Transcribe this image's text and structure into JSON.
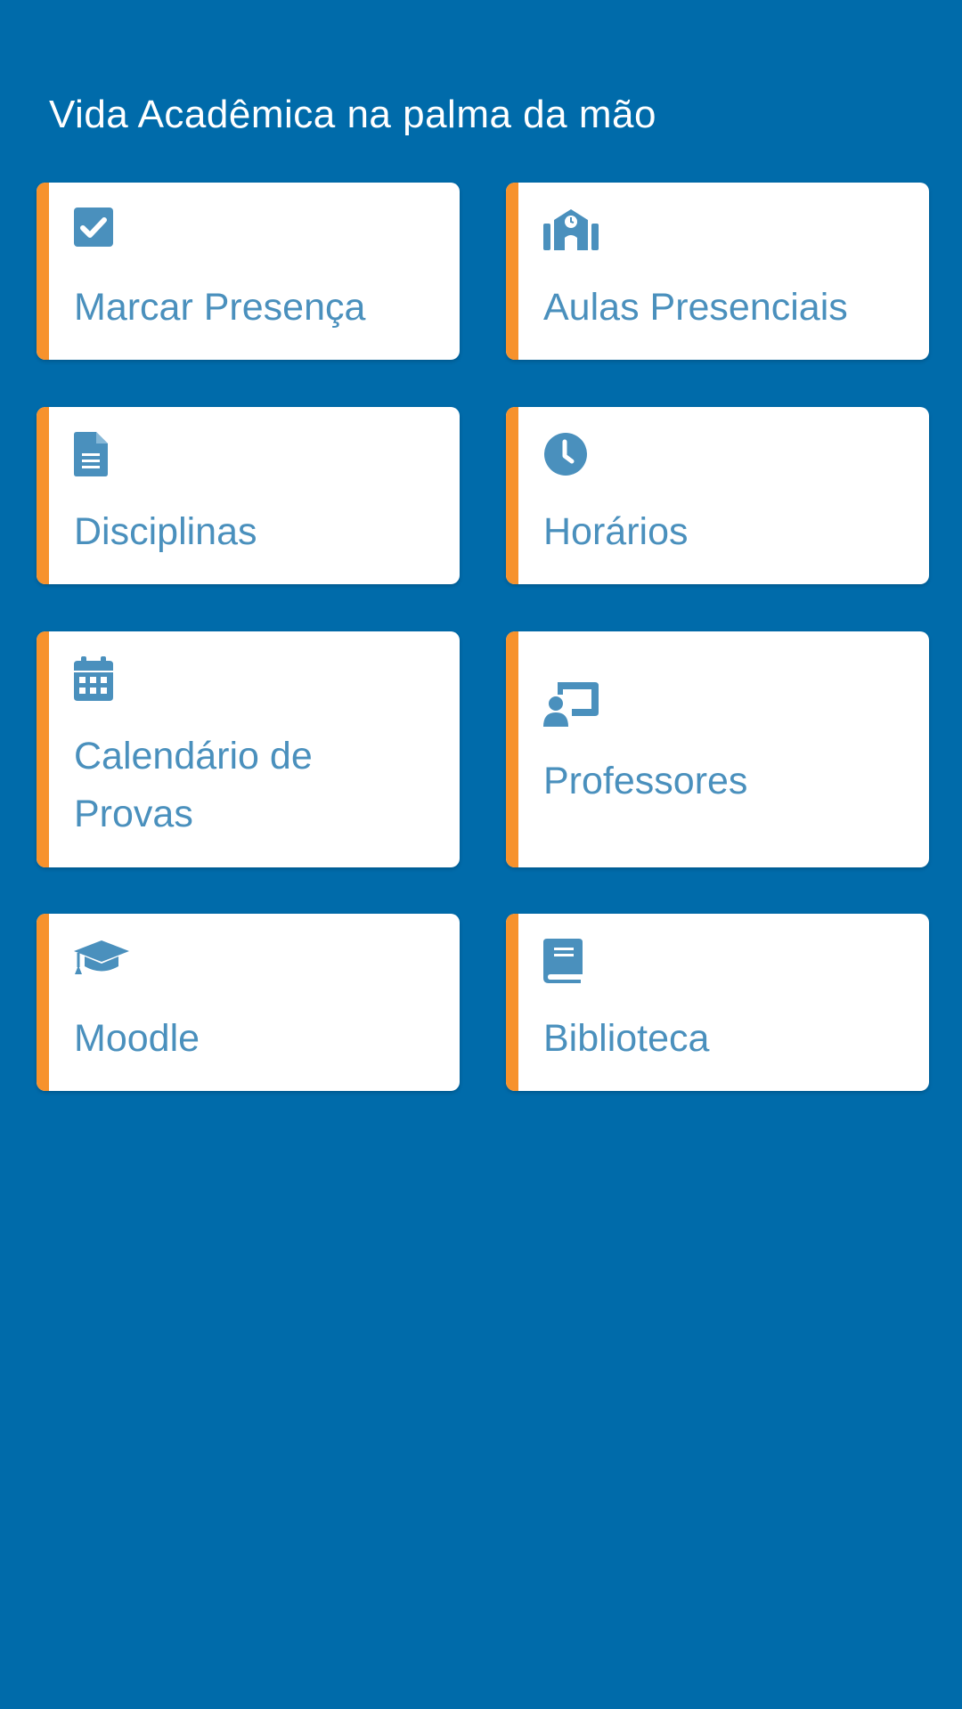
{
  "header": {
    "title": "Vida Acadêmica na palma da mão"
  },
  "theme": {
    "background": "#006BAA",
    "card_background": "#FFFFFF",
    "accent": "#F7922C",
    "icon_color": "#4A90BD",
    "text_color": "#4A90BD"
  },
  "menu": {
    "items": [
      {
        "label": "Marcar Presença",
        "icon": "check-square-icon"
      },
      {
        "label": "Aulas Presenciais",
        "icon": "school-building-icon"
      },
      {
        "label": "Disciplinas",
        "icon": "document-icon"
      },
      {
        "label": "Horários",
        "icon": "clock-icon"
      },
      {
        "label": "Calendário de Provas",
        "icon": "calendar-icon"
      },
      {
        "label": "Professores",
        "icon": "teacher-board-icon"
      },
      {
        "label": "Moodle",
        "icon": "graduation-cap-icon"
      },
      {
        "label": "Biblioteca",
        "icon": "book-icon"
      }
    ]
  }
}
